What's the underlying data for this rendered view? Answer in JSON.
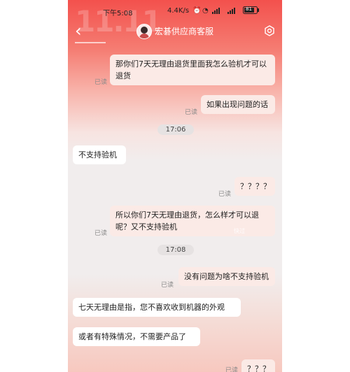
{
  "status_bar": {
    "time": "下午5:08",
    "speed": "4.4K/s",
    "battery": "81"
  },
  "header": {
    "title": "宏碁供应商客服"
  },
  "messages": [
    {
      "direction": "out",
      "text": "那你们7天无理由退货里面我怎么验机才可以退货",
      "read": "已读"
    },
    {
      "direction": "out",
      "text": "如果出现问题的话",
      "read": "已读"
    },
    {
      "type": "timestamp",
      "text": "17:06"
    },
    {
      "direction": "in",
      "text": "不支持验机"
    },
    {
      "direction": "out",
      "text": "？？？？",
      "read": "已读"
    },
    {
      "direction": "out",
      "text": "所以你们7天无理由退货，怎么样才可以退呢？又不支持验机",
      "read": "已读"
    },
    {
      "type": "timestamp",
      "text": "17:08"
    },
    {
      "direction": "out",
      "text": "没有问题为啥不支持验机",
      "read": "已读"
    },
    {
      "direction": "in",
      "text": "七天无理由是指，您不喜欢收到机器的外观"
    },
    {
      "direction": "in",
      "text": "或者有特殊情况，不需要产品了"
    },
    {
      "direction": "out",
      "text": "？？？",
      "read": "已读"
    }
  ],
  "overlay": "快过"
}
